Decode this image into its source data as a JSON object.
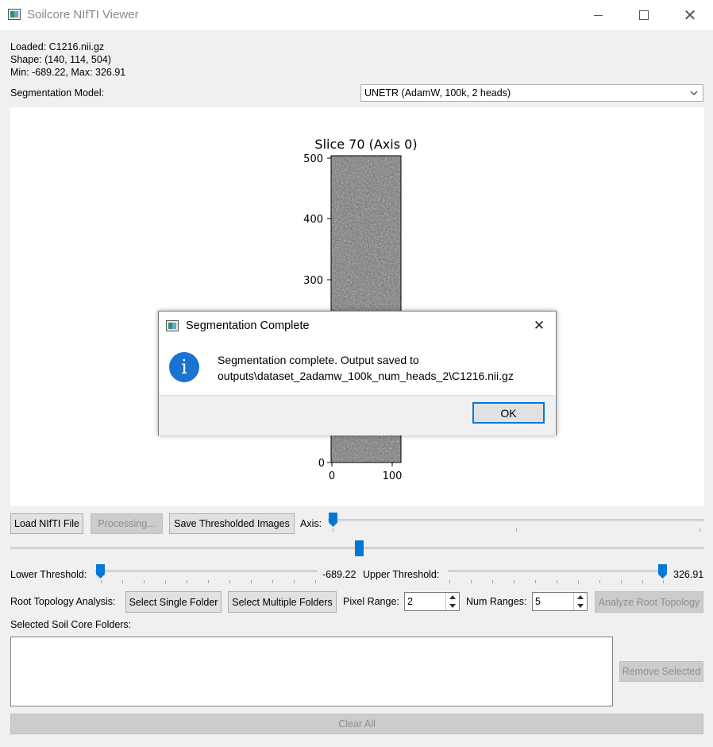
{
  "window": {
    "title": "Soilcore NIfTI Viewer",
    "minimize_icon": "minimize-icon",
    "maximize_icon": "maximize-icon",
    "close_glyph": "✕"
  },
  "info": {
    "loaded": "Loaded: C1216.nii.gz",
    "shape": "Shape: (140, 114, 504)",
    "minmax": "Min: -689.22, Max: 326.91"
  },
  "segmentation": {
    "label": "Segmentation Model:",
    "selected": "UNETR (AdamW, 100k, 2 heads)"
  },
  "plot": {
    "title": "Slice 70 (Axis 0)",
    "y_ticks": [
      "500",
      "400",
      "300",
      "0"
    ],
    "x_ticks": [
      "0",
      "100"
    ]
  },
  "toolbar": {
    "load_label": "Load NIfTI File",
    "processing_label": "Processing...",
    "save_label": "Save Thresholded Images",
    "axis_label": "Axis:"
  },
  "threshold": {
    "lower_label": "Lower Threshold:",
    "lower_value": "-689.22",
    "upper_label": "Upper Threshold:",
    "upper_value": "326.91"
  },
  "topology": {
    "label": "Root Topology Analysis:",
    "single_folder": "Select Single Folder",
    "multiple_folders": "Select Multiple Folders",
    "pixel_range_label": "Pixel Range:",
    "pixel_range_value": "2",
    "num_ranges_label": "Num Ranges:",
    "num_ranges_value": "5",
    "analyze_label": "Analyze Root Topology"
  },
  "folders": {
    "label": "Selected Soil Core Folders:",
    "remove_label": "Remove Selected",
    "clear_label": "Clear All"
  },
  "dialog": {
    "title": "Segmentation Complete",
    "message_line1": "Segmentation complete. Output saved to",
    "message_line2": "outputs\\dataset_2adamw_100k_num_heads_2\\C1216.nii.gz",
    "ok_label": "OK",
    "info_glyph": "i",
    "close_glyph": "✕"
  },
  "colors": {
    "accent": "#0078d7",
    "window_bg": "#f0f0f0",
    "info_icon": "#1a73d1"
  }
}
